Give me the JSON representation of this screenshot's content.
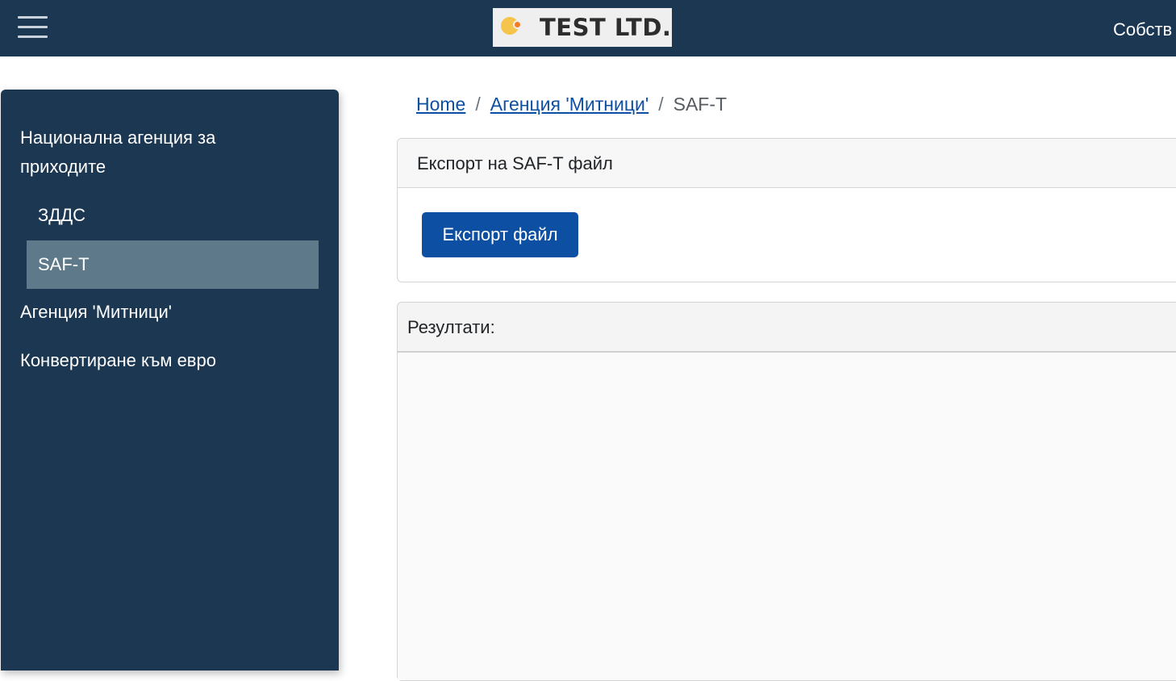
{
  "header": {
    "brand_text": "TEST LTD.",
    "right_text": "Собств"
  },
  "sidebar": {
    "items": [
      {
        "label": "Национална агенция за приходите"
      },
      {
        "label": "ЗДДС"
      },
      {
        "label": "SAF-T",
        "active": true
      },
      {
        "label": "Агенция 'Митници'"
      },
      {
        "label": "Конвертиране към евро"
      }
    ]
  },
  "breadcrumb": {
    "home": "Home",
    "sep": "/",
    "section": "Агенция 'Митници'",
    "current": "SAF-T"
  },
  "export_card": {
    "title": "Експорт на SAF-T файл",
    "button_label": "Експорт файл"
  },
  "results_card": {
    "title": "Резултати:"
  },
  "colors": {
    "navbar": "#1b3752",
    "sidebar_active": "#5e7a8a",
    "primary": "#0d4fa2"
  }
}
